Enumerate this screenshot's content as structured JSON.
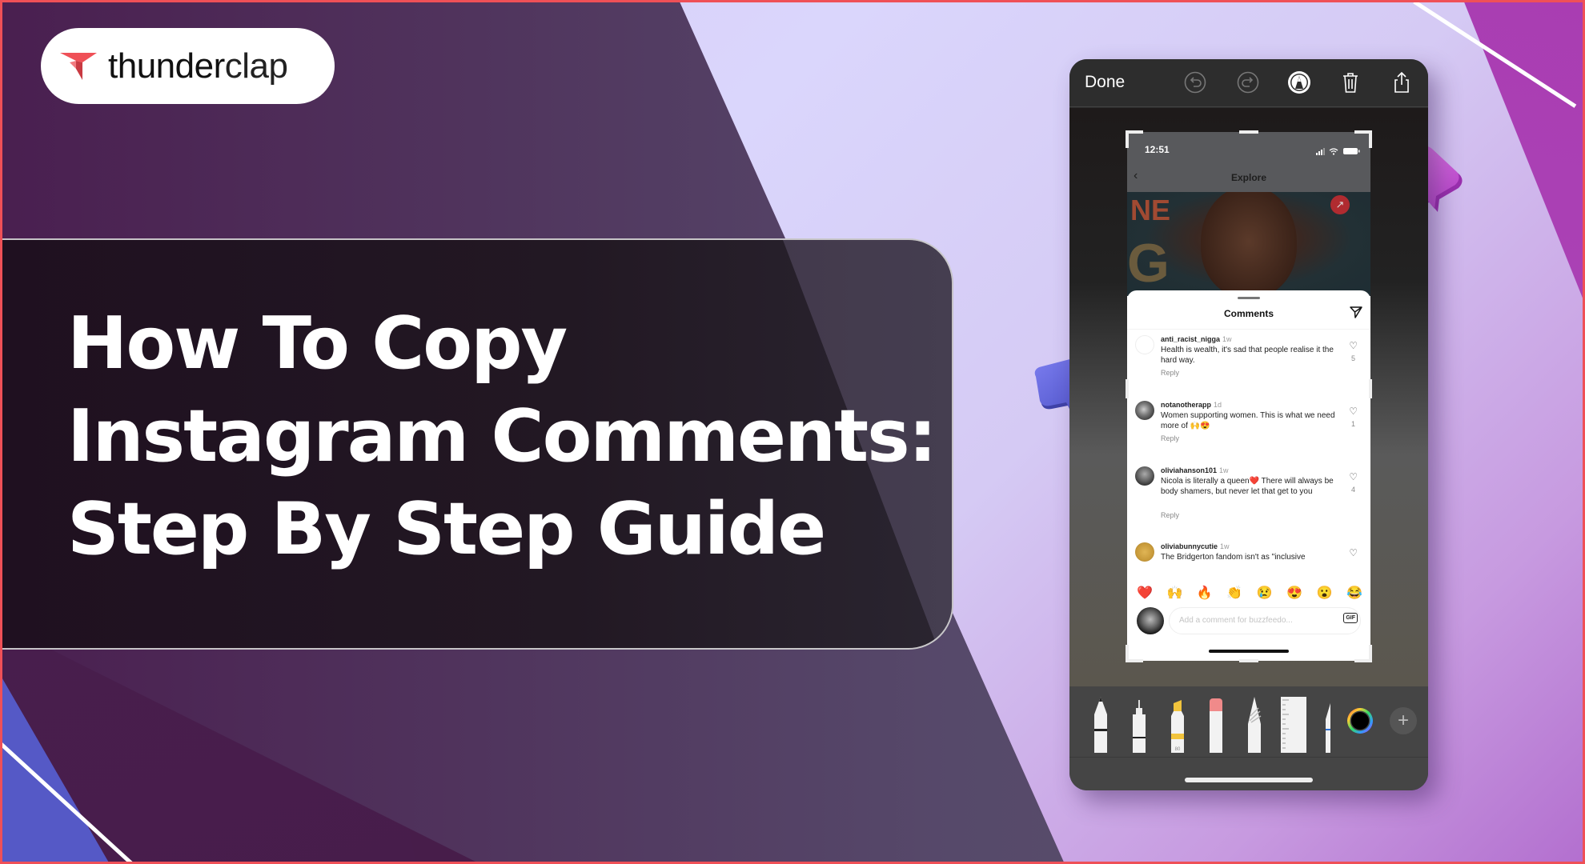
{
  "brand": {
    "name_bold": "thunder",
    "name_light": "clap",
    "logo_color": "#ef5057"
  },
  "headline": {
    "lines": [
      "How To Copy",
      "Instagram Comments:",
      "Step By Step Guide"
    ]
  },
  "colors": {
    "border": "#ef5057",
    "bg_dark": "#471d4a",
    "bg_light": "#dad6fc",
    "accent_purple": "#b052c0",
    "accent_blue": "#5559c6"
  },
  "markup_editor": {
    "done_label": "Done",
    "toolbar_icons": [
      "undo-icon",
      "redo-icon",
      "markup-pen-icon",
      "trash-icon",
      "share-icon"
    ],
    "tools": [
      "pen",
      "fineliner",
      "highlighter",
      "eraser",
      "lasso",
      "ruler",
      "pencil"
    ],
    "highlighter_label": "80",
    "color_picker": "color-wheel",
    "add_label": "+"
  },
  "instagram": {
    "status_time": "12:51",
    "nav_title": "Explore",
    "post_badge": "↗",
    "comments_title": "Comments",
    "comments": [
      {
        "user": "anti_racist_nigga",
        "age": "1w",
        "text": "Health is wealth, it's sad that people realise it the hard way.",
        "reply": "Reply",
        "likes": "5"
      },
      {
        "user": "notanotherapp",
        "age": "1d",
        "text": "Women supporting women. This is what we need more of 🙌😍",
        "reply": "Reply",
        "likes": "1"
      },
      {
        "user": "oliviahanson101",
        "age": "1w",
        "text": "Nicola is literally a queen❤️ There will always be body shamers, but never let that get to you",
        "reply": "Reply",
        "likes": "4"
      },
      {
        "user": "oliviabunnycutie",
        "age": "1w",
        "text": "The Bridgerton fandom isn't as \"inclusive",
        "reply": "",
        "likes": ""
      }
    ],
    "quick_emojis": [
      "❤️",
      "🙌",
      "🔥",
      "👏",
      "😢",
      "😍",
      "😮",
      "😂"
    ],
    "comment_placeholder": "Add a comment for buzzfeedo...",
    "gif_label": "GIF"
  }
}
